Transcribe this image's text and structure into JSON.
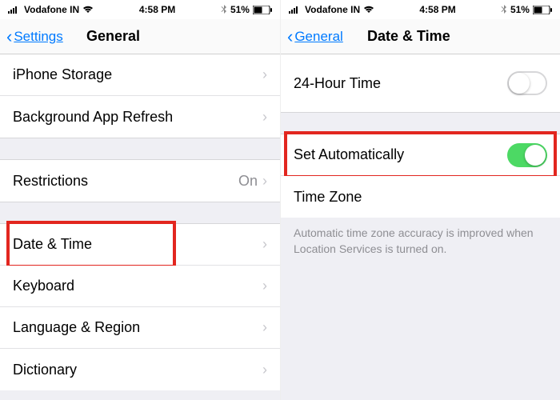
{
  "status": {
    "carrier": "Vodafone IN",
    "time": "4:58 PM",
    "battery_pct": "51%"
  },
  "left": {
    "back_label": "Settings",
    "title": "General",
    "rows": {
      "storage": "iPhone Storage",
      "background": "Background App Refresh",
      "restrictions": "Restrictions",
      "restrictions_value": "On",
      "datetime": "Date & Time",
      "keyboard": "Keyboard",
      "language": "Language & Region",
      "dictionary": "Dictionary"
    }
  },
  "right": {
    "back_label": "General",
    "title": "Date & Time",
    "rows": {
      "twentyfour": "24-Hour Time",
      "setauto": "Set Automatically",
      "timezone": "Time Zone"
    },
    "footer": "Automatic time zone accuracy is improved when Location Services is turned on."
  },
  "colors": {
    "accent": "#007aff",
    "toggle_on": "#4cd964",
    "highlight": "#e2261f"
  }
}
